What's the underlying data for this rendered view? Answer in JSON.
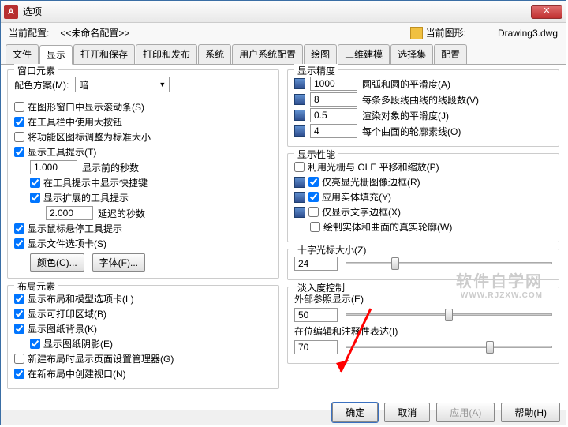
{
  "window": {
    "title": "选项"
  },
  "header": {
    "current_profile_label": "当前配置:",
    "current_profile_value": "<<未命名配置>>",
    "current_drawing_label": "当前图形:",
    "current_drawing_value": "Drawing3.dwg"
  },
  "tabs": [
    "文件",
    "显示",
    "打开和保存",
    "打印和发布",
    "系统",
    "用户系统配置",
    "绘图",
    "三维建模",
    "选择集",
    "配置"
  ],
  "active_tab": 1,
  "left": {
    "window_elements": {
      "title": "窗口元素",
      "color_scheme_label": "配色方案(M):",
      "color_scheme_value": "暗",
      "cb_scrollbar": "在图形窗口中显示滚动条(S)",
      "cb_largebtn": "在工具栏中使用大按钮",
      "cb_ribbonstd": "将功能区图标调整为标准大小",
      "cb_tooltips": "显示工具提示(T)",
      "tooltip_delay_val": "1.000",
      "tooltip_delay_lbl": "显示前的秒数",
      "cb_tt_shortcut": "在工具提示中显示快捷键",
      "cb_tt_ext": "显示扩展的工具提示",
      "ext_delay_val": "2.000",
      "ext_delay_lbl": "延迟的秒数",
      "cb_hover": "显示鼠标悬停工具提示",
      "cb_filetabs": "显示文件选项卡(S)",
      "btn_colors": "颜色(C)...",
      "btn_fonts": "字体(F)..."
    },
    "layout_elements": {
      "title": "布局元素",
      "cb_layout_tabs": "显示布局和模型选项卡(L)",
      "cb_printable": "显示可打印区域(B)",
      "cb_paperbg": "显示图纸背景(K)",
      "cb_papershadow": "显示图纸阴影(E)",
      "cb_pagesetup": "新建布局时显示页面设置管理器(G)",
      "cb_newviewport": "在新布局中创建视口(N)"
    }
  },
  "right": {
    "precision": {
      "title": "显示精度",
      "v1": "1000",
      "l1": "圆弧和圆的平滑度(A)",
      "v2": "8",
      "l2": "每条多段线曲线的线段数(V)",
      "v3": "0.5",
      "l3": "渲染对象的平滑度(J)",
      "v4": "4",
      "l4": "每个曲面的轮廓素线(O)"
    },
    "performance": {
      "title": "显示性能",
      "cb_ole": "利用光栅与 OLE 平移和缩放(P)",
      "cb_frame": "仅亮显光栅图像边框(R)",
      "cb_solidfill": "应用实体填充(Y)",
      "cb_textframe": "仅显示文字边框(X)",
      "cb_silhouette": "绘制实体和曲面的真实轮廓(W)"
    },
    "crosshair": {
      "title": "十字光标大小(Z)",
      "value": "24"
    },
    "fade": {
      "title": "淡入度控制",
      "xref_label": "外部参照显示(E)",
      "xref_value": "50",
      "inplace_label": "在位编辑和注释性表达(I)",
      "inplace_value": "70"
    }
  },
  "buttons": {
    "ok": "确定",
    "cancel": "取消",
    "apply": "应用(A)",
    "help": "帮助(H)"
  },
  "watermark": {
    "main": "软件自学网",
    "sub": "WWW.RJZXW.COM"
  }
}
